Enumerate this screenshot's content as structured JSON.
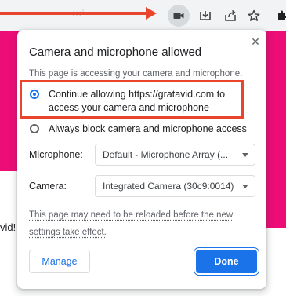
{
  "toolbar": {
    "faded_text": "ıııᴵ",
    "icons": [
      "camera-icon",
      "install-icon",
      "share-icon",
      "bookmark-star-icon",
      "extensions-icon"
    ]
  },
  "page": {
    "fragment_text": "vid!"
  },
  "popup": {
    "close_symbol": "✕",
    "title": "Camera and microphone allowed",
    "subtitle": "This page is accessing your camera and microphone.",
    "options": [
      {
        "label_line1": "Continue allowing https://gratavid.com to",
        "label_line2": "access your camera and microphone",
        "checked": true
      },
      {
        "label": "Always block camera and microphone access",
        "checked": false
      }
    ],
    "microphone": {
      "label": "Microphone:",
      "value": "Default - Microphone Array (..."
    },
    "camera": {
      "label": "Camera:",
      "value": "Integrated Camera (30c9:0014)"
    },
    "reload_note_line1": "This page may need to be reloaded before the new",
    "reload_note_line2": "settings take effect.",
    "manage_label": "Manage",
    "done_label": "Done"
  },
  "colors": {
    "accent": "#1a73e8",
    "annotation_red": "#e8452c",
    "site_pink": "#ec0d77"
  }
}
